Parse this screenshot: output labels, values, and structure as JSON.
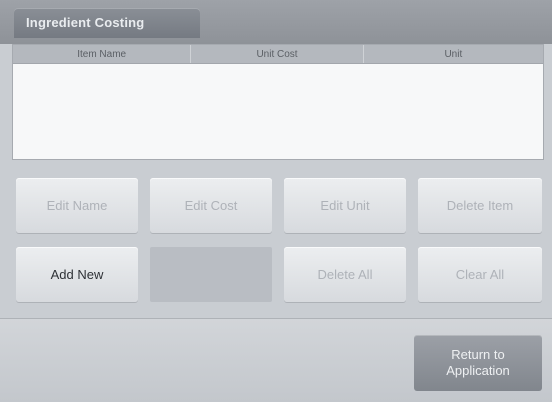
{
  "header": {
    "title": "Ingredient Costing"
  },
  "table": {
    "columns": [
      "Item Name",
      "Unit Cost",
      "Unit"
    ]
  },
  "buttons": {
    "edit_name": "Edit Name",
    "edit_cost": "Edit Cost",
    "edit_unit": "Edit Unit",
    "delete_item": "Delete Item",
    "add_new": "Add New",
    "delete_all": "Delete All",
    "clear_all": "Clear All"
  },
  "footer": {
    "return_line1": "Return to",
    "return_line2": "Application"
  }
}
